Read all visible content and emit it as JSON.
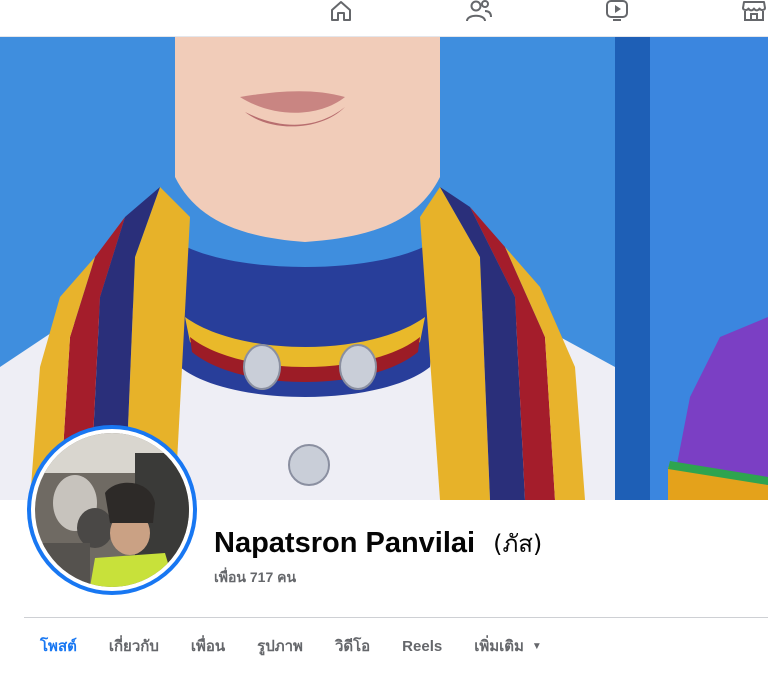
{
  "nav": {
    "items": [
      {
        "name": "home-icon"
      },
      {
        "name": "friends-icon"
      },
      {
        "name": "watch-icon"
      },
      {
        "name": "marketplace-icon"
      }
    ]
  },
  "profile": {
    "name": "Napatsron Panvilai",
    "alt_name": "(ภัส)",
    "friends_count": "เพื่อน 717 คน"
  },
  "tabs": [
    {
      "label": "โพสต์",
      "active": true
    },
    {
      "label": "เกี่ยวกับ",
      "active": false
    },
    {
      "label": "เพื่อน",
      "active": false
    },
    {
      "label": "รูปภาพ",
      "active": false
    },
    {
      "label": "วิดีโอ",
      "active": false
    },
    {
      "label": "Reels",
      "active": false
    },
    {
      "label": "เพิ่มเติม",
      "active": false
    }
  ],
  "colors": {
    "accent": "#1877f2",
    "cover_background": "#3f8ede",
    "secondary_text": "#65676b"
  }
}
